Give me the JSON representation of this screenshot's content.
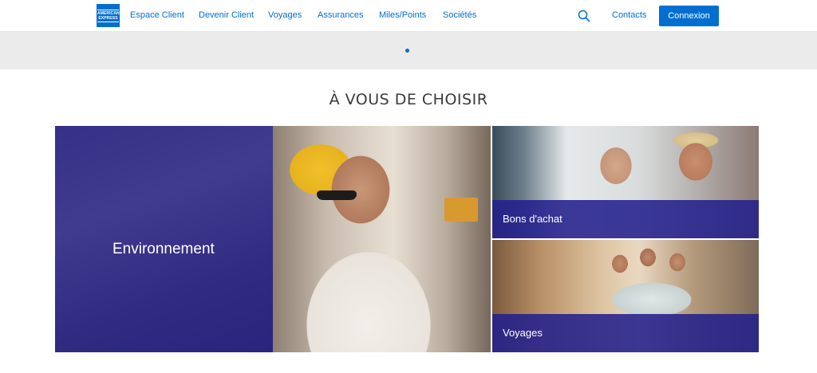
{
  "header": {
    "logo_text": "AMERICAN EXPRESS",
    "nav": [
      {
        "label": "Espace Client"
      },
      {
        "label": "Devenir Client"
      },
      {
        "label": "Voyages"
      },
      {
        "label": "Assurances"
      },
      {
        "label": "Miles/Points"
      },
      {
        "label": "Sociétés"
      }
    ],
    "search_icon": "search-icon",
    "contacts_label": "Contacts",
    "login_label": "Connexion"
  },
  "carousel": {
    "active_index": 1,
    "total": 1
  },
  "section": {
    "title": "À VOUS DE CHOISIR"
  },
  "tiles": {
    "environment": {
      "label": "Environnement"
    },
    "bons": {
      "label": "Bons d'achat"
    },
    "voyages": {
      "label": "Voyages"
    }
  },
  "colors": {
    "brand_blue": "#006fcf",
    "overlay_blue": "#23208c",
    "band_gray": "#ebebeb"
  }
}
